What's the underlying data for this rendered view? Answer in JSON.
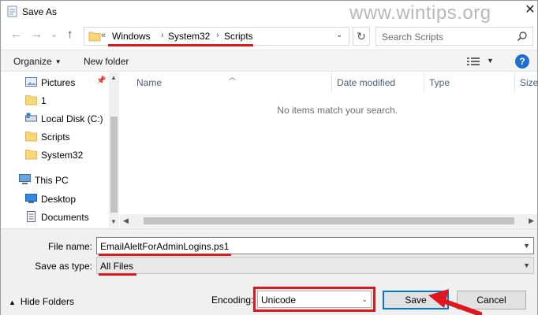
{
  "window": {
    "title": "Save As",
    "close_glyph": "✕"
  },
  "watermark": "www.wintips.org",
  "nav": {
    "back": "←",
    "forward": "→",
    "recent": "⌄",
    "up": "↑"
  },
  "address": {
    "overflow": "«",
    "crumbs": [
      "Windows",
      "System32",
      "Scripts"
    ],
    "dropdown": "⌄",
    "refresh": "↻"
  },
  "search": {
    "placeholder": "Search Scripts"
  },
  "toolbar": {
    "organize": "Organize",
    "new_folder": "New folder",
    "help": "?"
  },
  "navpane": {
    "items": [
      {
        "label": "Pictures",
        "icon": "pictures-icon",
        "pinned": true
      },
      {
        "label": "1",
        "icon": "folder-icon"
      },
      {
        "label": "Local Disk (C:)",
        "icon": "drive-icon"
      },
      {
        "label": "Scripts",
        "icon": "folder-icon"
      },
      {
        "label": "System32",
        "icon": "folder-icon"
      },
      {
        "label": "This PC",
        "icon": "computer-icon"
      },
      {
        "label": "Desktop",
        "icon": "desktop-icon"
      },
      {
        "label": "Documents",
        "icon": "documents-icon"
      }
    ]
  },
  "list": {
    "columns": [
      "Name",
      "Date modified",
      "Type",
      "Size"
    ],
    "empty_message": "No items match your search."
  },
  "form": {
    "file_name_label": "File name:",
    "file_name_value": "EmailAleltForAdminLogins.ps1",
    "save_type_label": "Save as type:",
    "save_type_value": "All Files",
    "encoding_label": "Encoding:",
    "encoding_value": "Unicode",
    "hide_folders": "Hide Folders",
    "save_button": "Save",
    "cancel_button": "Cancel"
  },
  "colors": {
    "accent": "#0078d7",
    "highlight": "#e0161d",
    "help": "#1e6fd0"
  }
}
